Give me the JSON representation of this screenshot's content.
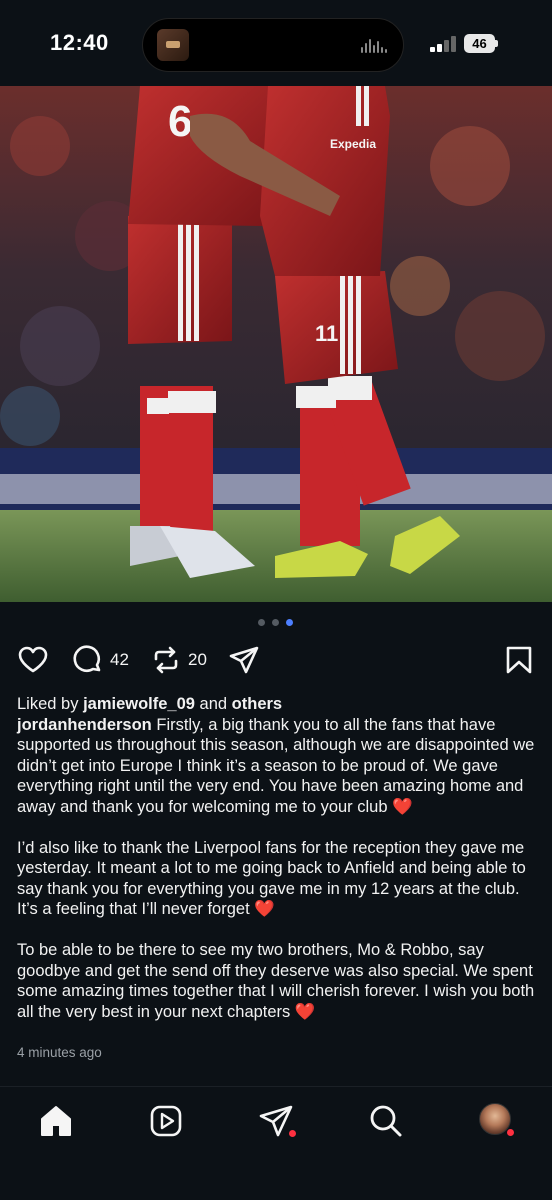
{
  "status_bar": {
    "time": "12:40",
    "battery": "46",
    "icons": [
      "signal-icon",
      "battery-icon",
      "audio-wave-icon"
    ]
  },
  "post": {
    "image_description_icons": [
      "photo"
    ],
    "carousel": {
      "count": 3,
      "active_index": 2
    },
    "actions": {
      "comments_count": "42",
      "reposts_count": "20"
    },
    "liked_by": {
      "prefix": "Liked by",
      "user": "jamiewolfe_09",
      "joiner": "and",
      "others": "others"
    },
    "author": "jordanhenderson",
    "caption_p1": "Firstly, a big thank you to all the fans that have supported us throughout this season, although we are disappointed we didn’t get into Europe I think it’s a season to be proud of. We gave everything right until the very end. You have been amazing home and away and thank you for welcoming me to your club",
    "caption_p2": "I’d also like to thank the Liverpool fans for the reception they gave me yesterday. It meant a lot to me going back to Anfield and being able to say thank you for everything you gave me in my 12 years at the club. It’s a feeling that I’ll never forget",
    "caption_p3": "To be able to be there to see my two brothers, Mo & Robbo, say goodbye and get the send off they deserve was also special. We spent some amazing times together that I will cherish forever. I wish you both all the very best in your next chapters",
    "heart_emoji": "❤️",
    "time_ago": "4 minutes ago"
  },
  "colors": {
    "background": "#0c1116",
    "accent_blue": "#4d7fff",
    "notification_red": "#ff3040",
    "heart_red": "#e2352d"
  },
  "navbar": {
    "items": [
      "home-icon",
      "reels-icon",
      "messages-icon",
      "search-icon",
      "profile-avatar"
    ]
  }
}
